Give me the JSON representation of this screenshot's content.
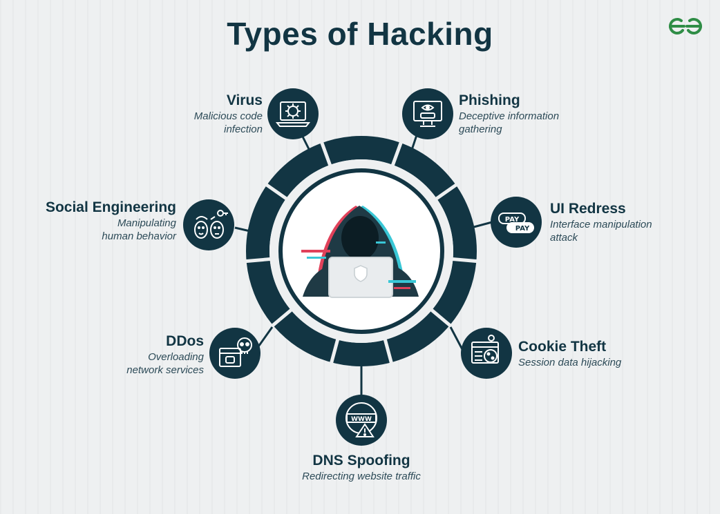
{
  "title": "Types of Hacking",
  "brand": {
    "logo_icon": "geeksforgeeks-logo-icon",
    "logo_color": "#2f8d46"
  },
  "colors": {
    "dark": "#123543",
    "accent_red": "#e0415a",
    "accent_cyan": "#39c7d6",
    "background": "#eef0f1"
  },
  "center_image": {
    "icon": "hooded-hacker-laptop-icon"
  },
  "types": [
    {
      "key": "virus",
      "title": "Virus",
      "desc_line1": "Malicious code",
      "desc_line2": "infection",
      "icon": "virus-laptop-icon"
    },
    {
      "key": "phishing",
      "title": "Phishing",
      "desc_line1": "Deceptive information",
      "desc_line2": "gathering",
      "icon": "phishing-monitor-icon"
    },
    {
      "key": "ui_redress",
      "title": "UI Redress",
      "desc_line1": "Interface manipulation",
      "desc_line2": "attack",
      "icon": "pay-button-icon",
      "icon_text_1": "PAY",
      "icon_text_2": "PAY"
    },
    {
      "key": "cookie_theft",
      "title": "Cookie Theft",
      "desc_line1": "Session data hijacking",
      "desc_line2": "",
      "icon": "cookie-browser-icon"
    },
    {
      "key": "dns_spoofing",
      "title": "DNS Spoofing",
      "desc_line1": "Redirecting website traffic",
      "desc_line2": "",
      "icon": "www-warning-icon",
      "icon_text_1": "WWW"
    },
    {
      "key": "ddos",
      "title": "DDos",
      "desc_line1": "Overloading",
      "desc_line2": "network services",
      "icon": "skull-browser-icon"
    },
    {
      "key": "social_engineering",
      "title": "Social Engineering",
      "desc_line1": "Manipulating",
      "desc_line2": "human behavior",
      "icon": "two-faces-icon"
    }
  ]
}
